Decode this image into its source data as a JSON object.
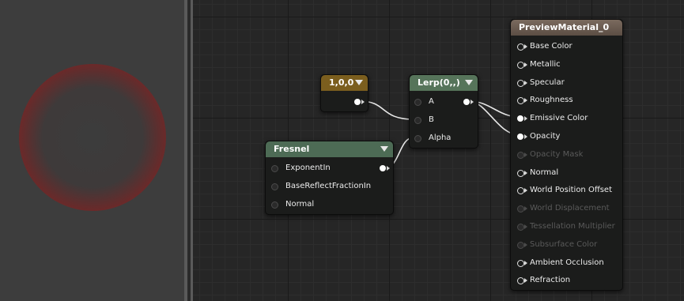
{
  "preview": {
    "label": "material-preview-sphere"
  },
  "nodes": {
    "constant": {
      "title": "1,0,0",
      "header_color": "#7b5e1e"
    },
    "lerp": {
      "title": "Lerp(0,,)",
      "header_color": "#56745a",
      "inputs": [
        "A",
        "B",
        "Alpha"
      ]
    },
    "fresnel": {
      "title": "Fresnel",
      "header_color": "#4d6b55",
      "inputs": [
        "ExponentIn",
        "BaseReflectFractionIn",
        "Normal"
      ]
    },
    "material": {
      "title": "PreviewMaterial_0",
      "header_color": "#6a5a4e",
      "inputs": [
        {
          "label": "Base Color",
          "enabled": true,
          "connected": false
        },
        {
          "label": "Metallic",
          "enabled": true,
          "connected": false
        },
        {
          "label": "Specular",
          "enabled": true,
          "connected": false
        },
        {
          "label": "Roughness",
          "enabled": true,
          "connected": false
        },
        {
          "label": "Emissive Color",
          "enabled": true,
          "connected": true
        },
        {
          "label": "Opacity",
          "enabled": true,
          "connected": true
        },
        {
          "label": "Opacity Mask",
          "enabled": false,
          "connected": false
        },
        {
          "label": "Normal",
          "enabled": true,
          "connected": false
        },
        {
          "label": "World Position Offset",
          "enabled": true,
          "connected": false
        },
        {
          "label": "World Displacement",
          "enabled": false,
          "connected": false
        },
        {
          "label": "Tessellation Multiplier",
          "enabled": false,
          "connected": false
        },
        {
          "label": "Subsurface Color",
          "enabled": false,
          "connected": false
        },
        {
          "label": "Ambient Occlusion",
          "enabled": true,
          "connected": false
        },
        {
          "label": "Refraction",
          "enabled": true,
          "connected": false
        }
      ]
    }
  }
}
